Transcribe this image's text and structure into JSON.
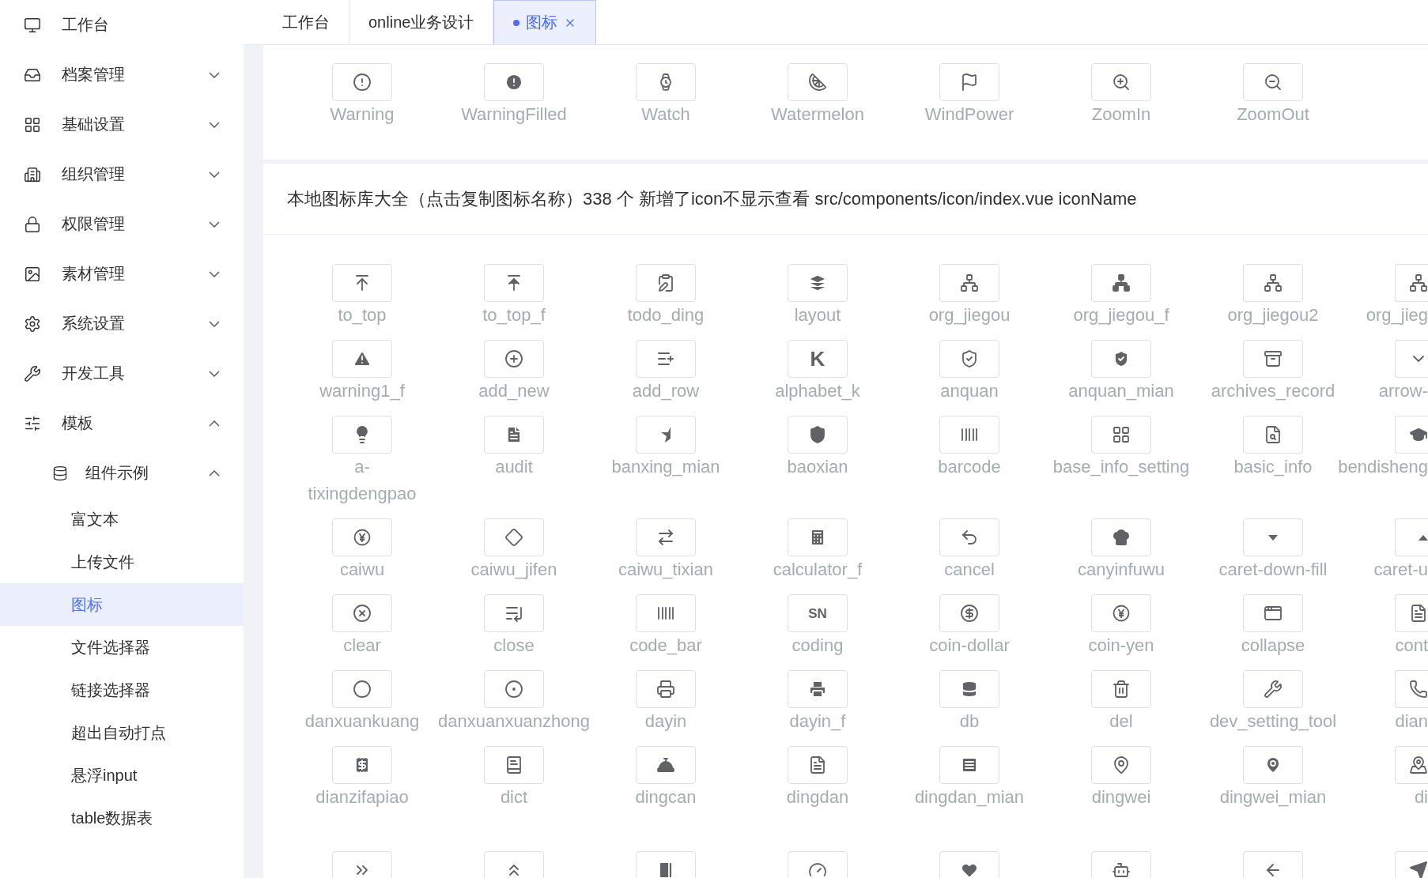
{
  "sidebar": {
    "items": [
      {
        "label": "工作台",
        "kind": "link",
        "selected": false
      },
      {
        "label": "档案管理",
        "kind": "submenu",
        "expanded": false
      },
      {
        "label": "基础设置",
        "kind": "submenu",
        "expanded": false
      },
      {
        "label": "组织管理",
        "kind": "submenu",
        "expanded": false
      },
      {
        "label": "权限管理",
        "kind": "submenu",
        "expanded": false
      },
      {
        "label": "素材管理",
        "kind": "submenu",
        "expanded": false
      },
      {
        "label": "系统设置",
        "kind": "submenu",
        "expanded": false
      },
      {
        "label": "开发工具",
        "kind": "submenu",
        "expanded": false
      },
      {
        "label": "模板",
        "kind": "submenu",
        "expanded": true,
        "children": [
          {
            "label": "组件示例",
            "kind": "submenu",
            "expanded": true,
            "children": [
              {
                "label": "富文本",
                "kind": "link",
                "selected": false
              },
              {
                "label": "上传文件",
                "kind": "link",
                "selected": false
              },
              {
                "label": "图标",
                "kind": "link",
                "selected": true
              },
              {
                "label": "文件选择器",
                "kind": "link",
                "selected": false
              },
              {
                "label": "链接选择器",
                "kind": "link",
                "selected": false
              },
              {
                "label": "超出自动打点",
                "kind": "link",
                "selected": false
              },
              {
                "label": "悬浮input",
                "kind": "link",
                "selected": false
              },
              {
                "label": "table数据表",
                "kind": "link",
                "selected": false
              }
            ]
          }
        ]
      }
    ]
  },
  "tabs": [
    {
      "label": "工作台",
      "selected": false
    },
    {
      "label": "online业务设计",
      "selected": false
    },
    {
      "label": "图标",
      "selected": true
    }
  ],
  "top_icons": [
    {
      "label": "Warning"
    },
    {
      "label": "WarningFilled"
    },
    {
      "label": "Watch"
    },
    {
      "label": "Watermelon"
    },
    {
      "label": "WindPower"
    },
    {
      "label": "ZoomIn"
    },
    {
      "label": "ZoomOut"
    }
  ],
  "library": {
    "title": "本地图标库大全（点击复制图标名称）338 个 新增了icon不显示查看 src/components/icon/index.vue iconName",
    "rows": [
      [
        {
          "label": "to_top"
        },
        {
          "label": "to_top_f"
        },
        {
          "label": "todo_ding"
        },
        {
          "label": "layout"
        },
        {
          "label": "org_jiegou"
        },
        {
          "label": "org_jiegou_f"
        },
        {
          "label": "org_jiegou2"
        },
        {
          "label": "org_jieg"
        }
      ],
      [
        {
          "label": "warning1_f"
        },
        {
          "label": "add_new"
        },
        {
          "label": "add_row"
        },
        {
          "label": "alphabet_k",
          "glyph": "K"
        },
        {
          "label": "anquan"
        },
        {
          "label": "anquan_mian"
        },
        {
          "label": "archives_record"
        },
        {
          "label": "arrow-"
        }
      ],
      [
        {
          "label": "a-tixingdengpao"
        },
        {
          "label": "audit"
        },
        {
          "label": "banxing_mian"
        },
        {
          "label": "baoxian"
        },
        {
          "label": "barcode"
        },
        {
          "label": "base_info_setting"
        },
        {
          "label": "basic_info"
        },
        {
          "label": "bendisheng"
        }
      ],
      [
        {
          "label": "caiwu"
        },
        {
          "label": "caiwu_jifen"
        },
        {
          "label": "caiwu_tixian"
        },
        {
          "label": "calculator_f"
        },
        {
          "label": "cancel"
        },
        {
          "label": "canyinfuwu"
        },
        {
          "label": "caret-down-fill"
        },
        {
          "label": "caret-u"
        }
      ],
      [
        {
          "label": "clear"
        },
        {
          "label": "close"
        },
        {
          "label": "code_bar"
        },
        {
          "label": "coding",
          "glyph": "SN"
        },
        {
          "label": "coin-dollar"
        },
        {
          "label": "coin-yen"
        },
        {
          "label": "collapse"
        },
        {
          "label": "cont"
        }
      ],
      [
        {
          "label": "danxuankuang"
        },
        {
          "label": "danxuanxuanzhong"
        },
        {
          "label": "dayin"
        },
        {
          "label": "dayin_f"
        },
        {
          "label": "db"
        },
        {
          "label": "del"
        },
        {
          "label": "dev_setting_tool"
        },
        {
          "label": "dian"
        }
      ],
      [
        {
          "label": "dianzifapiao"
        },
        {
          "label": "dict"
        },
        {
          "label": "dingcan"
        },
        {
          "label": "dingdan"
        },
        {
          "label": "dingdan_mian"
        },
        {
          "label": "dingwei"
        },
        {
          "label": "dingwei_mian"
        },
        {
          "label": "di"
        }
      ]
    ]
  }
}
